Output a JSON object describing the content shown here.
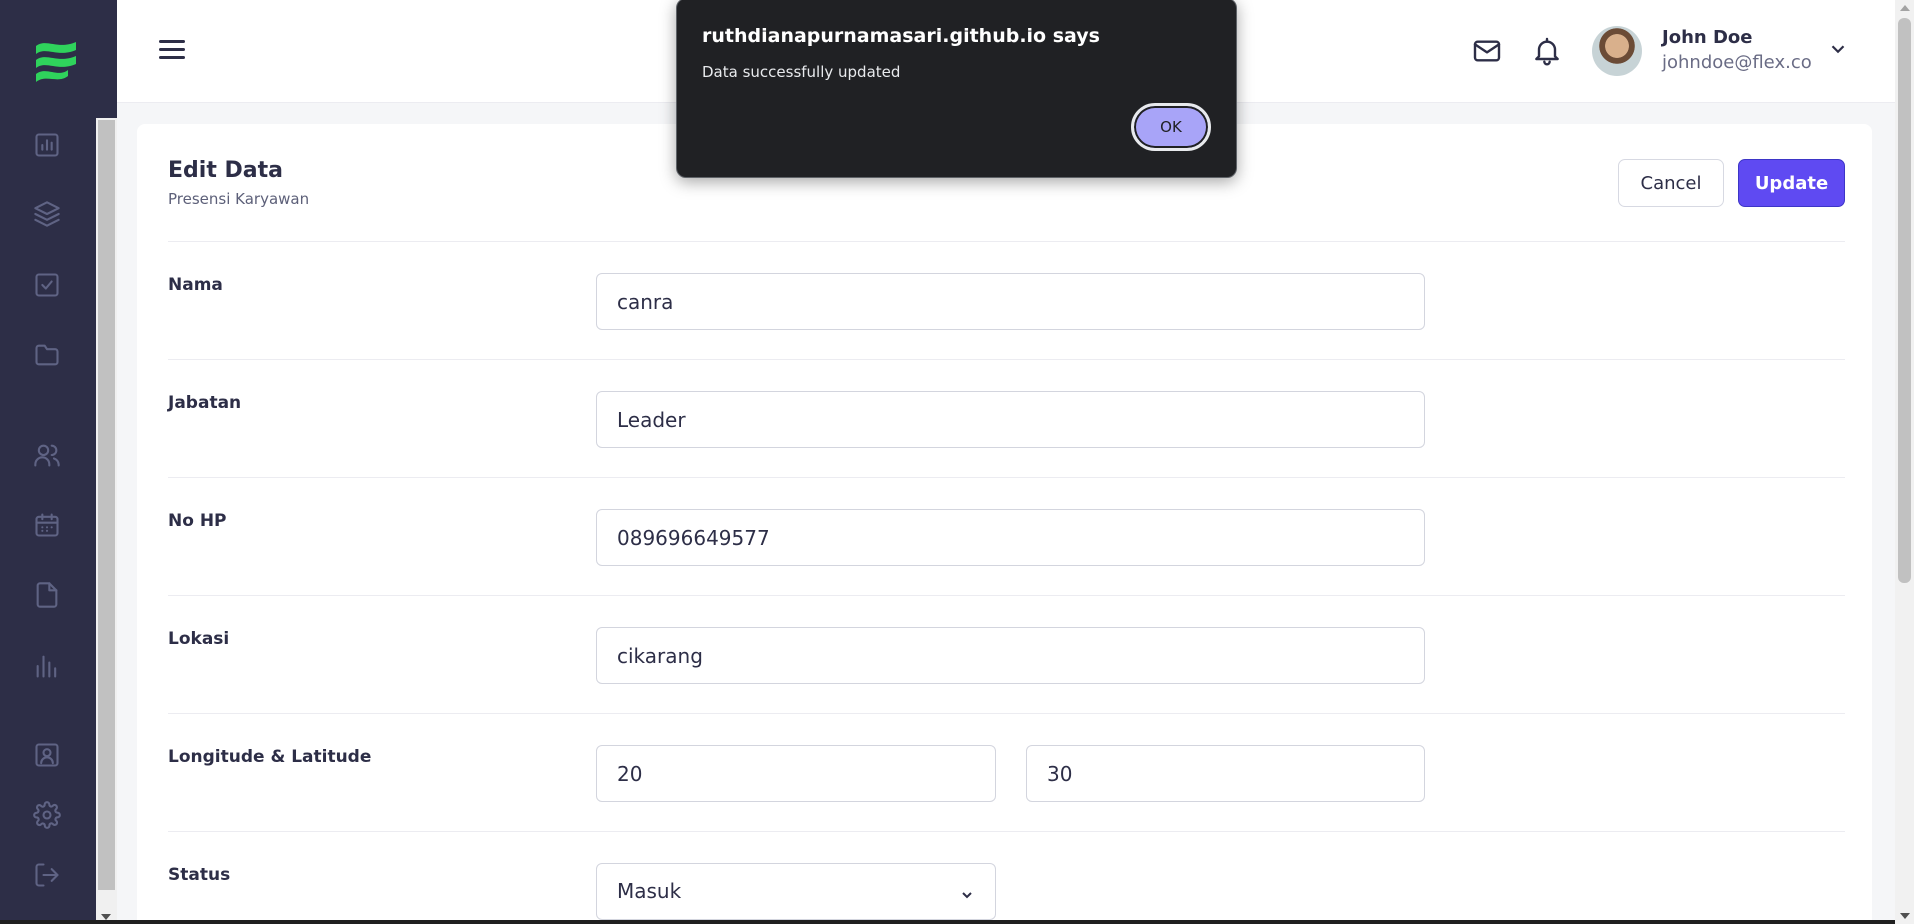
{
  "sidebar": {
    "icons": [
      "analytics-icon",
      "layers-icon",
      "checkbox-icon",
      "folder-icon",
      "users-icon",
      "calendar-icon",
      "document-icon",
      "bar-chart-icon",
      "contact-icon",
      "settings-icon",
      "logout-icon"
    ]
  },
  "header": {
    "user": {
      "name": "John Doe",
      "email": "johndoe@flex.co"
    }
  },
  "card": {
    "title": "Edit Data",
    "subtitle": "Presensi Karyawan",
    "cancel_label": "Cancel",
    "update_label": "Update"
  },
  "form": {
    "nama": {
      "label": "Nama",
      "value": "canra"
    },
    "jabatan": {
      "label": "Jabatan",
      "value": "Leader"
    },
    "no_hp": {
      "label": "No HP",
      "value": "089696649577"
    },
    "lokasi": {
      "label": "Lokasi",
      "value": "cikarang"
    },
    "coords": {
      "label": "Longitude & Latitude",
      "longitude": "20",
      "latitude": "30"
    },
    "status": {
      "label": "Status",
      "value": "Masuk"
    }
  },
  "dialog": {
    "title": "ruthdianapurnamasari.github.io says",
    "message": "Data successfully updated",
    "ok_label": "OK"
  },
  "colors": {
    "sidebar_bg": "#2d2e47",
    "accent": "#5f4af2",
    "logo": "#2fd35c",
    "dialog_bg": "#202124",
    "dialog_button": "#a8a4f8"
  }
}
